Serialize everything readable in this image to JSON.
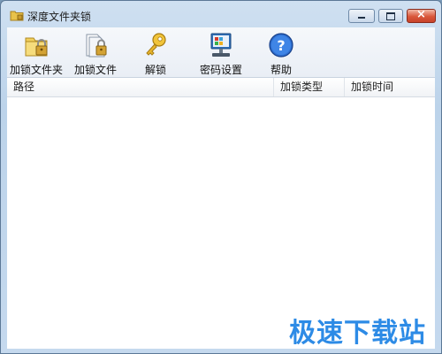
{
  "window": {
    "title": "深度文件夹锁",
    "controls": {
      "minimize": "minimize",
      "maximize": "maximize",
      "close": "×"
    }
  },
  "toolbar": {
    "items": [
      {
        "label": "加锁文件夹",
        "icon": "locked-folder-icon"
      },
      {
        "label": "加锁文件",
        "icon": "locked-file-icon"
      },
      {
        "label": "解锁",
        "icon": "key-icon"
      },
      {
        "label": "密码设置",
        "icon": "password-settings-icon"
      },
      {
        "label": "帮助",
        "icon": "help-icon"
      }
    ]
  },
  "list": {
    "columns": [
      "路径",
      "加锁类型",
      "加锁时间"
    ],
    "rows": []
  },
  "watermark": "极速下载站",
  "colors": {
    "accent": "#2d8be6",
    "titlebar": "#c5d9ee",
    "close_button": "#d9573a"
  }
}
